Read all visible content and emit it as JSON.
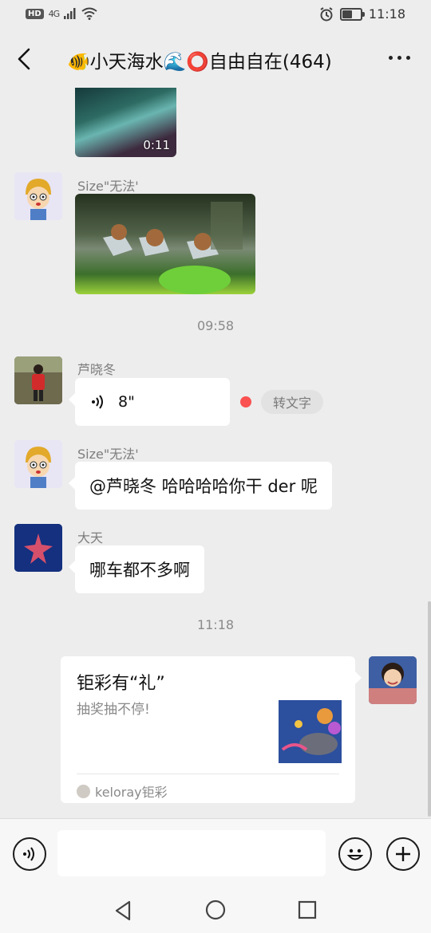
{
  "status_bar": {
    "hd": "HD",
    "network": "4G",
    "time": "11:18",
    "battery_level": 0.5
  },
  "header": {
    "title": "🐠小天海水🌊⭕自由自在(464)",
    "back_icon": "chevron-left-icon",
    "more_icon": "more-dots-icon"
  },
  "messages": {
    "video": {
      "duration": "0:11"
    },
    "photo_sender": "Size\"无法'",
    "time_1": "09:58",
    "voice_sender": "芦晓冬",
    "voice_length": "8\"",
    "transcribe_label": "转文字",
    "text1_sender": "Size\"无法'",
    "text1": "@芦晓冬  哈哈哈哈你干 der 呢",
    "text2_sender": "大天",
    "text2": "哪车都不多啊",
    "time_2": "11:18",
    "card": {
      "title": "钜彩有“礼”",
      "desc": "抽奖抽不停!",
      "source": "keloray钜彩"
    }
  },
  "input_bar": {
    "voice_icon": "voice-icon",
    "emoji_icon": "emoji-icon",
    "plus_icon": "plus-icon"
  },
  "nav_bar": {
    "back_icon": "nav-back-icon",
    "home_icon": "nav-home-icon",
    "recents_icon": "nav-recents-icon"
  }
}
